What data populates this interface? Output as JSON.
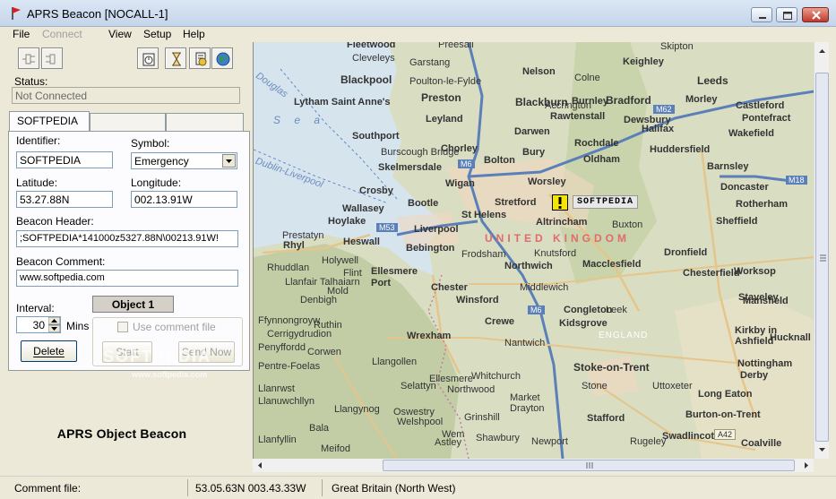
{
  "window": {
    "title": "APRS Beacon [NOCALL-1]"
  },
  "menu": [
    "File",
    "Connect",
    "View",
    "Setup",
    "Help"
  ],
  "status": {
    "label": "Status:",
    "value": "Not Connected"
  },
  "tabs": [
    "SOFTPEDIA",
    "",
    ""
  ],
  "form": {
    "identifier_label": "Identifier:",
    "identifier_value": "SOFTPEDIA",
    "symbol_label": "Symbol:",
    "symbol_value": "Emergency",
    "latitude_label": "Latitude:",
    "latitude_value": "53.27.88N",
    "longitude_label": "Longitude:",
    "longitude_value": "002.13.91W",
    "header_label": "Beacon Header:",
    "header_value": ";SOFTPEDIA*141000z5327.88N\\00213.91W!",
    "comment_label": "Beacon Comment:",
    "comment_value": "www.softpedia.com",
    "object_label": "Object 1",
    "interval_label": "Interval:",
    "interval_value": "30",
    "interval_unit": "Mins",
    "delete_label": "Delete",
    "use_comment_file_label": "Use comment file",
    "start_label": "Start",
    "send_now_label": "Send Now"
  },
  "watermark": "SOFTPEDIA",
  "watermark_url": "www.softpedia.com",
  "app_caption": "APRS Object Beacon",
  "map": {
    "beacon_label": "SOFTPEDIA",
    "country_label": "UNITED KINGDOM",
    "region_label": "ENGLAND",
    "towns": [
      "Fleetwood",
      "Cleveleys",
      "Preesall",
      "Garstang",
      "Blackpool",
      "Poulton-le-Fylde",
      "Lytham Saint Anne's",
      "Preston",
      "Leyland",
      "Southport",
      "Burscough Bridge",
      "Skelmersdale",
      "Chorley",
      "Wigan",
      "Bolton",
      "Bury",
      "Rochdale",
      "Oldham",
      "Worsley",
      "Stretford",
      "Altrincham",
      "St Helens",
      "Crosby",
      "Bootle",
      "Wallasey",
      "Hoylake",
      "Liverpool",
      "Rhyl",
      "Heswall",
      "Bebington",
      "Ellesmere Port",
      "Chester",
      "Northwich",
      "Winsford",
      "Crewe",
      "Nantwich",
      "Middlewich",
      "Frodsham",
      "Knutsford",
      "Macclesfield",
      "Congleton",
      "Kidsgrove",
      "Stoke-on-Trent",
      "Stafford",
      "Stone",
      "Leek",
      "Buxton",
      "Chesterfield",
      "Mansfield",
      "Dronfield",
      "Sheffield",
      "Rotherham",
      "Barnsley",
      "Wakefield",
      "Huddersfield",
      "Halifax",
      "Bradford",
      "Leeds",
      "Keighley",
      "Skipton",
      "Nelson",
      "Colne",
      "Blackburn",
      "Burnley",
      "Rawtenstall",
      "Darwen",
      "Accrington",
      "Dewsbury",
      "Morley",
      "Castleford",
      "Pontefract",
      "Doncaster",
      "Worksop",
      "Staveley",
      "Kirkby in Ashfield",
      "Hucknall",
      "Nottingham",
      "Derby",
      "Long Eaton",
      "Burton-on-Trent",
      "Swadlincote",
      "Coalville",
      "Uttoxeter",
      "Rugeley",
      "Wrexham",
      "Ruthin",
      "Denbigh",
      "Llangollen",
      "Oswestry",
      "Whitchurch",
      "Market Drayton",
      "Newport",
      "Shawbury",
      "Ellesmere",
      "Wem",
      "Mold",
      "Flint",
      "Holywell",
      "Prestatyn",
      "Llanrwst",
      "Llangynog",
      "Welshpool",
      "Meifod",
      "Llanfyllin",
      "Selattyn",
      "Northwood",
      "Grinshill",
      "Astley",
      "Penyffordd",
      "Llanfair Talhaiarn",
      "Rhuddlan",
      "Ffynnongroyw",
      "Pentre-Foelas",
      "Cerrigydrudion",
      "Corwen",
      "Bala",
      "Llanuwchllyn"
    ],
    "roads": [
      "M6",
      "M62",
      "M18",
      "M53",
      "A42"
    ],
    "sea_labels": [
      "Douglas",
      "Dublin-Liverpool",
      "S e a"
    ]
  },
  "statusbar": {
    "comment_file_label": "Comment file:",
    "coords": "53.05.63N   003.43.33W",
    "region": "Great Britain (North West)"
  },
  "colors": {
    "window_bg": "#ece9d8",
    "map_land": "#d9ddc2",
    "map_sea": "#d6e4ee",
    "country_label": "#e06c6c",
    "major_road": "#e6c58a"
  }
}
